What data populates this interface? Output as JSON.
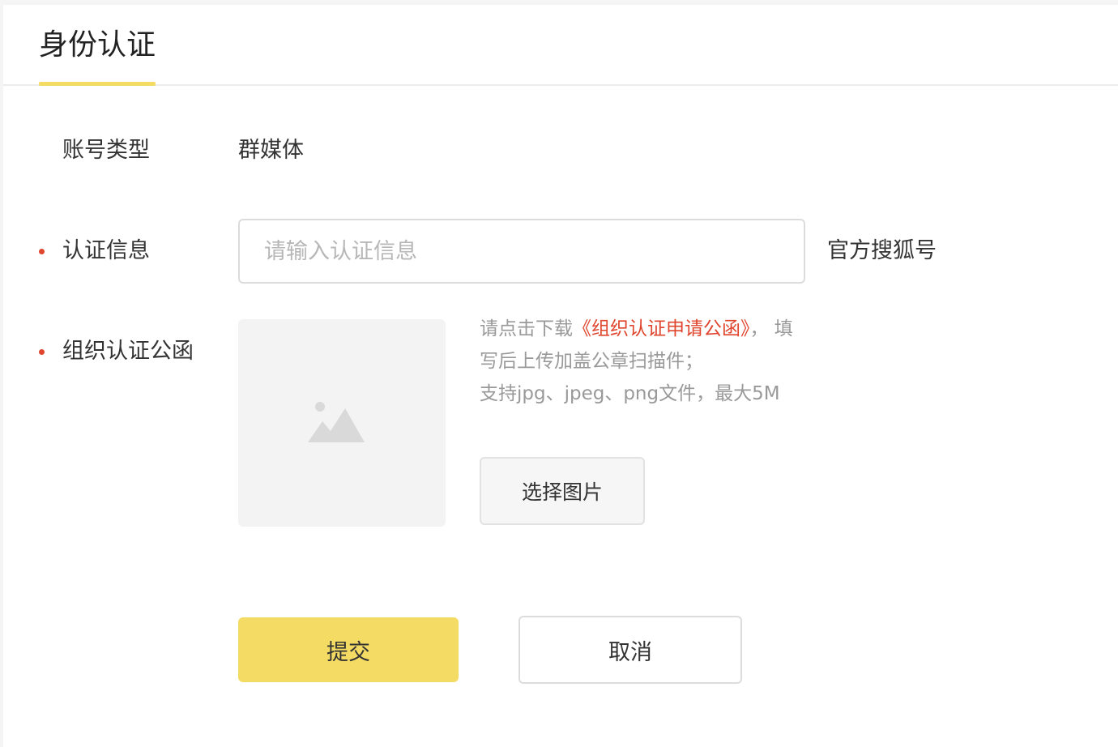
{
  "tabs": {
    "active_label": "身份认证"
  },
  "form": {
    "account_type": {
      "label": "账号类型",
      "value": "群媒体"
    },
    "auth_info": {
      "label": "认证信息",
      "required": true,
      "value": "",
      "placeholder": "请输入认证信息",
      "suffix": "官方搜狐号"
    },
    "org_letter": {
      "label": "组织认证公函",
      "required": true,
      "hint_prefix": "请点击下载",
      "hint_link": "《组织认证申请公函》",
      "hint_after_link": "， 填",
      "hint_line2": "写后上传加盖公章扫描件；",
      "hint_line3": "支持jpg、jpeg、png文件，最大5M",
      "select_button": "选择图片",
      "image_placeholder_icon": "image-placeholder-icon"
    }
  },
  "actions": {
    "submit_label": "提交",
    "cancel_label": "取消"
  },
  "colors": {
    "accent": "#f4dc64",
    "required_dot": "#e0452e",
    "link": "#e0452e",
    "hint_text": "#999999",
    "placeholder_text": "#b7b7b7"
  }
}
